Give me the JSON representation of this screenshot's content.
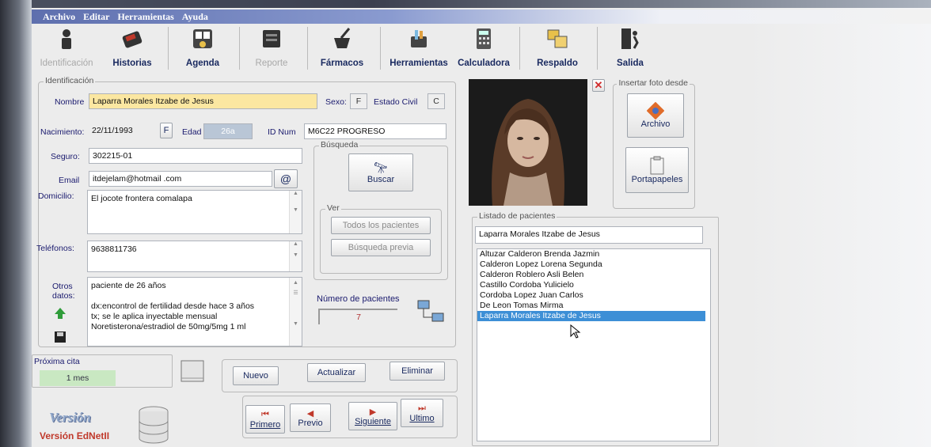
{
  "menu": [
    "Archivo",
    "Editar",
    "Herramientas",
    "Ayuda"
  ],
  "toolbar": [
    {
      "label": "Identificación",
      "icon": "person-icon",
      "enabled": false
    },
    {
      "label": "Historias",
      "icon": "history-book-icon",
      "enabled": true
    },
    {
      "label": "Agenda",
      "icon": "calendar-icon",
      "enabled": true
    },
    {
      "label": "Reporte",
      "icon": "report-icon",
      "enabled": false
    },
    {
      "label": "Fármacos",
      "icon": "mortar-icon",
      "enabled": true
    },
    {
      "label": "Herramientas",
      "icon": "tools-icon",
      "enabled": true
    },
    {
      "label": "Calculadora",
      "icon": "calculator-icon",
      "enabled": true
    },
    {
      "label": "Respaldo",
      "icon": "backup-icon",
      "enabled": true
    },
    {
      "label": "Salida",
      "icon": "exit-door-icon",
      "enabled": true
    }
  ],
  "ident": {
    "title": "Identificación",
    "nombre_label": "Nombre",
    "nombre": "Laparra Morales Itzabe de Jesus",
    "sexo_label": "Sexo:",
    "sexo": "F",
    "estado_label": "Estado Civil",
    "estado": "C",
    "nac_label": "Nacimiento:",
    "nacimiento": "22/11/1993",
    "f_btn": "F",
    "edad_label": "Edad",
    "edad": "26a",
    "idnum_label": "ID Num",
    "idnum": "M6C22 PROGRESO",
    "seguro_label": "Seguro:",
    "seguro": "302215-01",
    "email_label": "Email",
    "email": "itdejelam@hotmail .com",
    "at_btn": "@",
    "domicilio_label": "Domicilio:",
    "domicilio": "El jocote frontera comalapa",
    "tel_label": "Teléfonos:",
    "telefono": "9638811736",
    "otros_label1": "Otros",
    "otros_label2": "datos:",
    "otros": [
      "paciente de 26 años",
      "",
      "dx:encontrol de fertilidad desde hace 3 años",
      "tx; se le aplica inyectable mensual",
      "Noretisterona/estradiol de 50mg/5mg 1 ml"
    ]
  },
  "busqueda": {
    "title": "Búsqueda",
    "buscar": "Buscar",
    "ver_title": "Ver",
    "todos": "Todos los pacientes",
    "previa": "Búsqueda previa"
  },
  "numero": {
    "label": "Número de pacientes",
    "value": "7"
  },
  "proxima": {
    "title": "Próxima cita",
    "value": "1 mes"
  },
  "actions": {
    "nuevo": "Nuevo",
    "actualizar": "Actualizar",
    "eliminar": "Eliminar"
  },
  "nav": {
    "primero": "Primero",
    "previo": "Previo",
    "siguiente": "Siguiente",
    "ultimo": "Ultimo"
  },
  "version": {
    "logo": "Versión",
    "text": "Versión EdNetII"
  },
  "foto": {
    "title": "Insertar foto desde",
    "archivo": "Archivo",
    "portapapeles": "Portapapeles"
  },
  "listado": {
    "title": "Listado de pacientes",
    "search": "Laparra Morales Itzabe de Jesus",
    "items": [
      "Altuzar Calderon Brenda Jazmin",
      "Calderon Lopez Lorena Segunda",
      "Calderon Roblero Asli Belen",
      "Castillo Cordoba Yulicielo",
      "Cordoba Lopez Juan Carlos",
      "De Leon Tomas Mirma",
      "Laparra Morales Itzabe de Jesus"
    ],
    "selected_index": 6
  }
}
